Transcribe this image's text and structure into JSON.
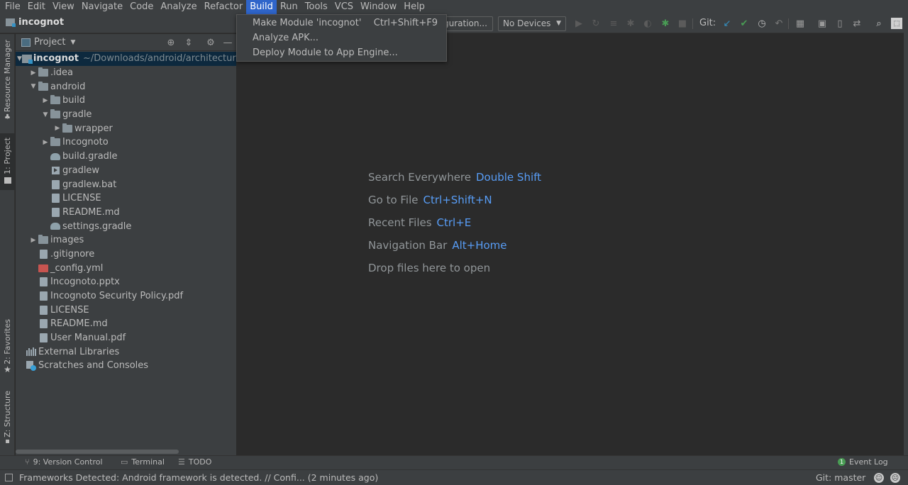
{
  "menubar": {
    "items": [
      "File",
      "Edit",
      "View",
      "Navigate",
      "Code",
      "Analyze",
      "Refactor",
      "Build",
      "Run",
      "Tools",
      "VCS",
      "Window",
      "Help"
    ],
    "active": "Build"
  },
  "build_menu": {
    "items": [
      {
        "label": "Make Module 'incognot'",
        "shortcut": "Ctrl+Shift+F9"
      },
      {
        "label": "Analyze APK...",
        "shortcut": ""
      },
      {
        "label": "Deploy Module to App Engine...",
        "shortcut": ""
      }
    ]
  },
  "navbar": {
    "project_name": "incognot",
    "config_button": "guration...",
    "devices_select": "No Devices",
    "git_label": "Git:"
  },
  "left_strip": {
    "resource_manager": "Resource Manager",
    "project": "1: Project",
    "favorites": "2: Favorites",
    "structure": "Z: Structure"
  },
  "project_panel": {
    "title": "Project",
    "tree": [
      {
        "label": "incognot",
        "path": "~/Downloads/android/architecture-",
        "indent": 0,
        "arrow": "down",
        "icon": "module",
        "bold": true,
        "selected": true
      },
      {
        "label": ".idea",
        "indent": 1,
        "arrow": "right",
        "icon": "folder"
      },
      {
        "label": "android",
        "indent": 1,
        "arrow": "down",
        "icon": "folder"
      },
      {
        "label": "build",
        "indent": 2,
        "arrow": "right",
        "icon": "folder"
      },
      {
        "label": "gradle",
        "indent": 2,
        "arrow": "down",
        "icon": "folder"
      },
      {
        "label": "wrapper",
        "indent": 3,
        "arrow": "right",
        "icon": "folder"
      },
      {
        "label": "Incognoto",
        "indent": 2,
        "arrow": "right",
        "icon": "folder"
      },
      {
        "label": "build.gradle",
        "indent": 2,
        "arrow": "none",
        "icon": "gradle"
      },
      {
        "label": "gradlew",
        "indent": 2,
        "arrow": "none",
        "icon": "run"
      },
      {
        "label": "gradlew.bat",
        "indent": 2,
        "arrow": "none",
        "icon": "file"
      },
      {
        "label": "LICENSE",
        "indent": 2,
        "arrow": "none",
        "icon": "file"
      },
      {
        "label": "README.md",
        "indent": 2,
        "arrow": "none",
        "icon": "file"
      },
      {
        "label": "settings.gradle",
        "indent": 2,
        "arrow": "none",
        "icon": "gradle"
      },
      {
        "label": "images",
        "indent": 1,
        "arrow": "right",
        "icon": "folder"
      },
      {
        "label": ".gitignore",
        "indent": 1,
        "arrow": "none",
        "icon": "file"
      },
      {
        "label": "_config.yml",
        "indent": 1,
        "arrow": "none",
        "icon": "yml"
      },
      {
        "label": "Incognoto.pptx",
        "indent": 1,
        "arrow": "none",
        "icon": "file"
      },
      {
        "label": "Incognoto Security Policy.pdf",
        "indent": 1,
        "arrow": "none",
        "icon": "file"
      },
      {
        "label": "LICENSE",
        "indent": 1,
        "arrow": "none",
        "icon": "file"
      },
      {
        "label": "README.md",
        "indent": 1,
        "arrow": "none",
        "icon": "file"
      },
      {
        "label": "User Manual.pdf",
        "indent": 1,
        "arrow": "none",
        "icon": "file"
      },
      {
        "label": "External Libraries",
        "indent": 0,
        "arrow": "right-hidden",
        "icon": "lib"
      },
      {
        "label": "Scratches and Consoles",
        "indent": 0,
        "arrow": "none-hidden",
        "icon": "scratch"
      }
    ]
  },
  "editor_hints": [
    {
      "text": "Search Everywhere",
      "key": "Double Shift"
    },
    {
      "text": "Go to File",
      "key": "Ctrl+Shift+N"
    },
    {
      "text": "Recent Files",
      "key": "Ctrl+E"
    },
    {
      "text": "Navigation Bar",
      "key": "Alt+Home"
    },
    {
      "text": "Drop files here to open",
      "key": ""
    }
  ],
  "bottom_tools": {
    "version_control": "9: Version Control",
    "terminal": "Terminal",
    "todo": "TODO",
    "event_log": "Event Log",
    "event_count": "1"
  },
  "status": {
    "message": "Frameworks Detected: Android framework is detected. // Confi... (2 minutes ago)",
    "git": "Git: master"
  },
  "colors": {
    "background": "#2b2b2b",
    "panel": "#3c3f41",
    "accent": "#2f65ca",
    "link": "#589df6",
    "selection": "#0d293e"
  }
}
